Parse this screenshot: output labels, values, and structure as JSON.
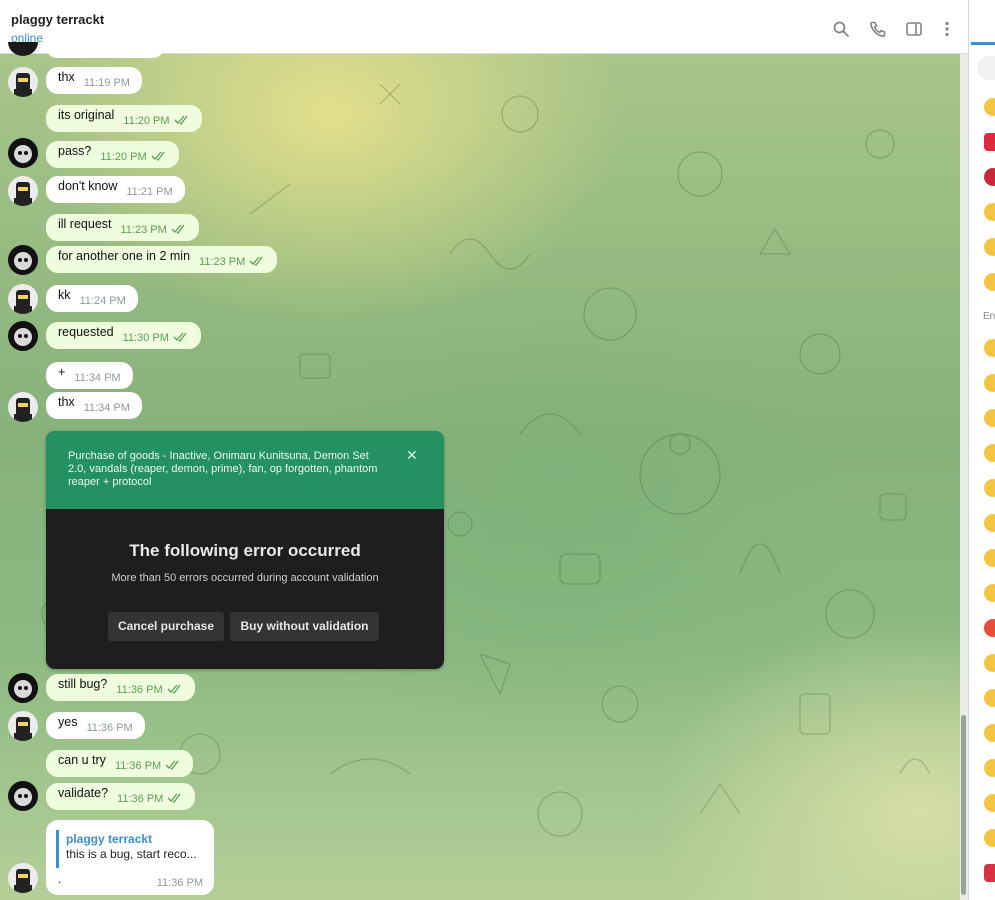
{
  "header": {
    "chat_name": "plaggy terrackt",
    "status": "online",
    "icons": [
      "search-icon",
      "phone-icon",
      "sidebar-toggle-icon",
      "more-vertical-icon"
    ]
  },
  "messages": [
    {
      "direction": "in",
      "text": "thx",
      "time": "11:19 PM"
    },
    {
      "direction": "out",
      "text": "its original",
      "time": "11:20 PM",
      "read": true
    },
    {
      "direction": "out",
      "text": "pass?",
      "time": "11:20 PM",
      "read": true
    },
    {
      "direction": "in",
      "text": "don't know",
      "time": "11:21 PM"
    },
    {
      "direction": "out",
      "text": "ill request",
      "time": "11:23 PM",
      "read": true
    },
    {
      "direction": "out",
      "text": "for another one in 2 min",
      "time": "11:23 PM",
      "read": true
    },
    {
      "direction": "in",
      "text": "kk",
      "time": "11:24 PM"
    },
    {
      "direction": "out",
      "text": "requested",
      "time": "11:30 PM",
      "read": true
    },
    {
      "direction": "in",
      "text": "+",
      "time": "11:34 PM"
    },
    {
      "direction": "in",
      "text": "thx",
      "time": "11:34 PM"
    },
    {
      "direction": "out",
      "text": "still bug?",
      "time": "11:36 PM",
      "read": true
    },
    {
      "direction": "in",
      "text": "yes",
      "time": "11:36 PM"
    },
    {
      "direction": "out",
      "text": "can u try",
      "time": "11:36 PM",
      "read": true
    },
    {
      "direction": "out",
      "text": "validate?",
      "time": "11:36 PM",
      "read": true
    }
  ],
  "error_dialog": {
    "title": "Purchase of goods - Inactive, Onimaru Kunitsuna, Demon Set 2.0, vandals (reaper, demon, prime), fan, op forgotten, phantom reaper + protocol",
    "heading": "The following error occurred",
    "message": "More than 50 errors occurred during account validation",
    "buttons": [
      "Cancel purchase",
      "Buy without validation"
    ],
    "accent_color": "#249260"
  },
  "reply": {
    "quoted_author": "plaggy terrackt",
    "quoted_text": "this is a bug, start reco...",
    "text": ".",
    "time": "11:36 PM"
  },
  "emoji_panel": {
    "section_label": "En"
  },
  "colors": {
    "accent": "#3a8fd1",
    "outgoing_bubble": "#effdde",
    "incoming_bubble": "#ffffff",
    "read_checks": "#5ba053"
  }
}
